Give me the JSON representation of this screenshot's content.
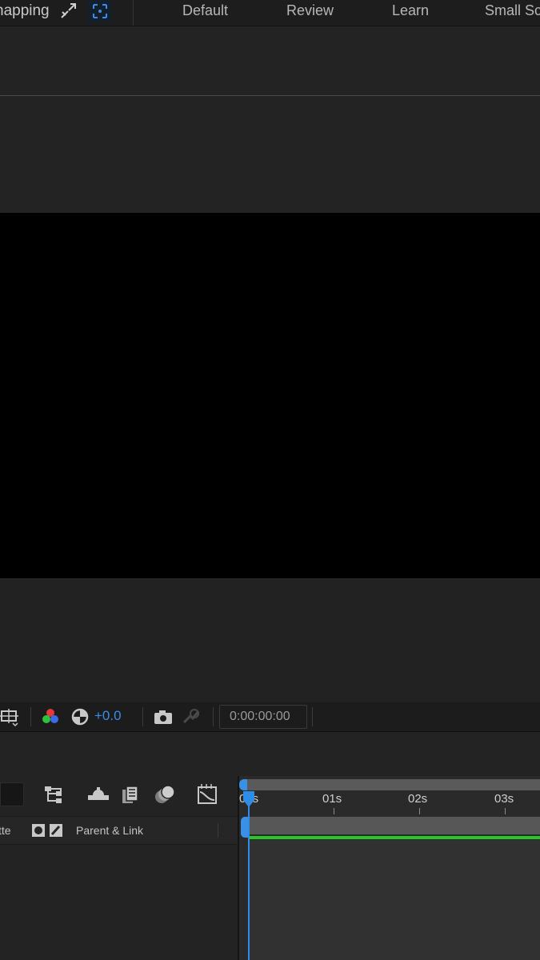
{
  "header": {
    "snapping_label": "napping",
    "workspaces": [
      "Default",
      "Review",
      "Learn",
      "Small Scr"
    ]
  },
  "viewer_toolbar": {
    "exposure": "+0.0",
    "timecode": "0:00:00:00"
  },
  "timeline": {
    "columns": {
      "matte_label": "tte",
      "parent_label": "Parent & Link"
    },
    "ruler_labels": [
      "00s",
      "01s",
      "02s",
      "03s"
    ]
  },
  "colors": {
    "accent_blue": "#2f8de8",
    "green_track": "#28c828",
    "canvas": "#000000"
  },
  "icons": {
    "top": [
      "snap-arrow-icon",
      "snap-target-icon"
    ],
    "viewer_toolbar": [
      "region-of-interest-icon",
      "color-channels-icon",
      "exposure-reset-icon",
      "camera-snapshot-icon",
      "show-snapshot-icon"
    ],
    "timeline": [
      "search-icon",
      "hierarchy-icon",
      "shy-layer-icon",
      "frame-blending-icon",
      "motion-blur-icon",
      "graph-editor-icon",
      "solo-switch-icon",
      "adjustment-switch-icon"
    ]
  }
}
